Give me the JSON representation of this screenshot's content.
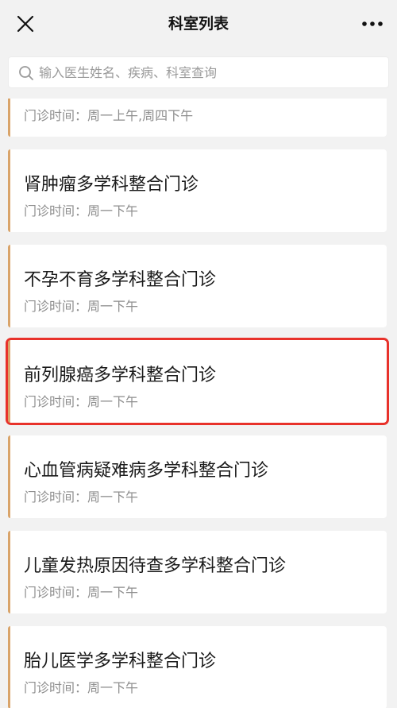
{
  "header": {
    "title": "科室列表"
  },
  "search": {
    "placeholder": "输入医生姓名、疾病、科室查询"
  },
  "departments": [
    {
      "name": "",
      "time": "门诊时间：周一上午,周四下午"
    },
    {
      "name": "肾肿瘤多学科整合门诊",
      "time": "门诊时间：周一下午"
    },
    {
      "name": "不孕不育多学科整合门诊",
      "time": "门诊时间：周一下午"
    },
    {
      "name": "前列腺癌多学科整合门诊",
      "time": "门诊时间：周一下午"
    },
    {
      "name": "心血管病疑难病多学科整合门诊",
      "time": "门诊时间：周一下午"
    },
    {
      "name": "儿童发热原因待查多学科整合门诊",
      "time": "门诊时间：周一下午"
    },
    {
      "name": "胎儿医学多学科整合门诊",
      "time": "门诊时间：周一下午"
    }
  ],
  "colors": {
    "accent": "#d9a46a",
    "highlight": "#e8322b"
  }
}
